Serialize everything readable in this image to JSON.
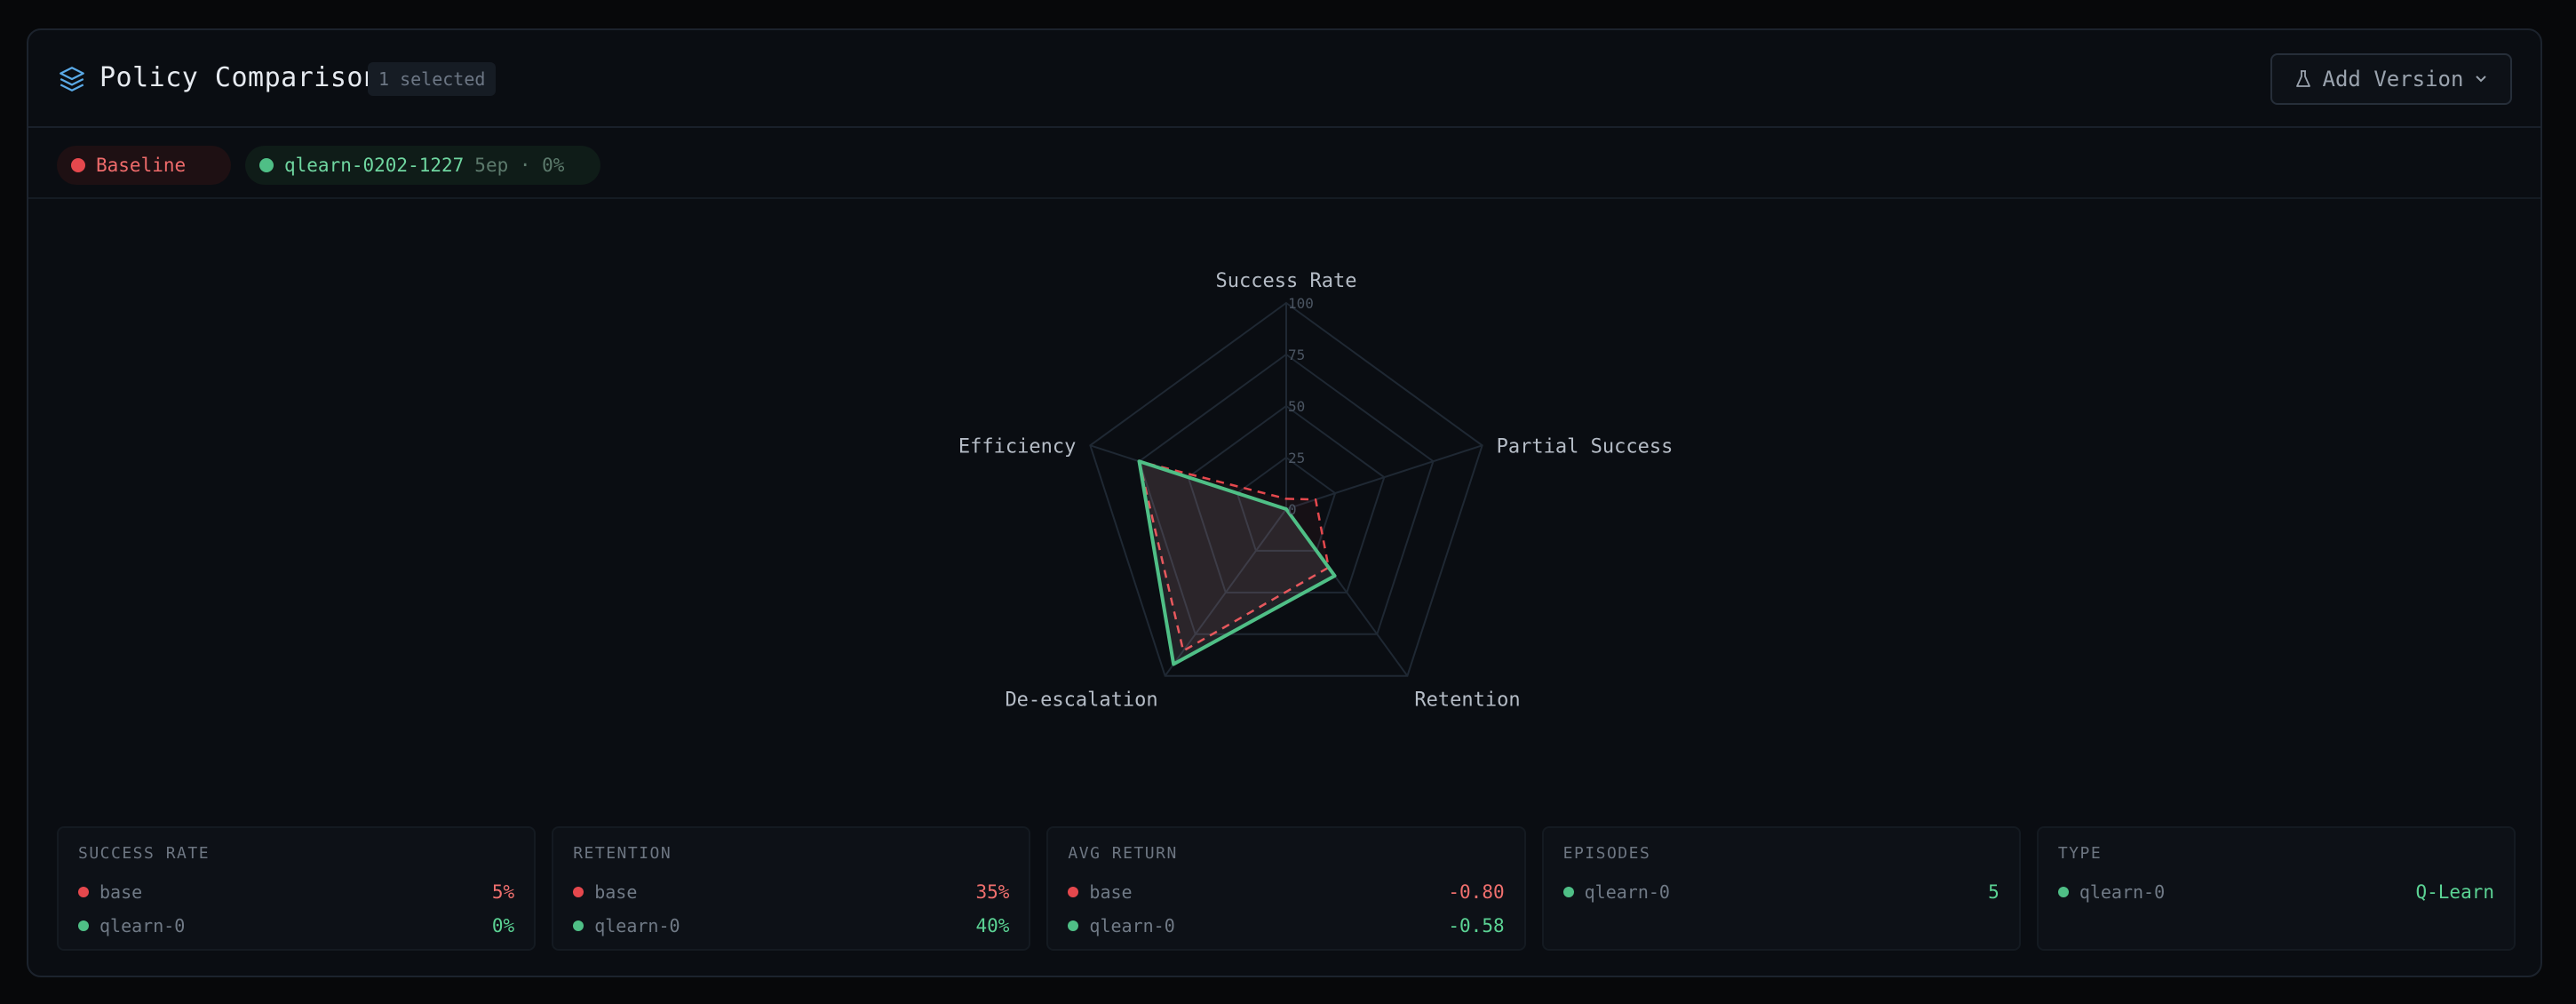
{
  "header": {
    "title": "Policy Comparison",
    "selected_badge": "1 selected",
    "add_version_label": "Add Version"
  },
  "chips": [
    {
      "label": "Baseline",
      "color": "#e5484d"
    },
    {
      "label": "qlearn-0202-1227",
      "meta": "5ep · 0%",
      "color": "#4fbf86"
    }
  ],
  "chart_data": {
    "type": "radar",
    "axes": [
      "Success Rate",
      "Partial Success",
      "Retention",
      "De-escalation",
      "Efficiency"
    ],
    "ticks": [
      "100",
      "75",
      "50",
      "25",
      "0"
    ],
    "rmax": 100,
    "grid": true,
    "series": [
      {
        "name": "Baseline",
        "color": "#e5484d",
        "style": "dashed",
        "values": [
          5,
          15,
          35,
          85,
          75
        ]
      },
      {
        "name": "qlearn-0202-1227",
        "color": "#4fbf86",
        "style": "solid",
        "values": [
          0,
          0,
          40,
          93,
          75
        ]
      }
    ]
  },
  "stats": {
    "success_rate": {
      "title": "SUCCESS RATE",
      "rows": [
        {
          "name": "base",
          "value": "5%"
        },
        {
          "name": "qlearn-0",
          "value": "0%"
        }
      ]
    },
    "retention": {
      "title": "RETENTION",
      "rows": [
        {
          "name": "base",
          "value": "35%"
        },
        {
          "name": "qlearn-0",
          "value": "40%"
        }
      ]
    },
    "avg_return": {
      "title": "AVG RETURN",
      "rows": [
        {
          "name": "base",
          "value": "-0.80"
        },
        {
          "name": "qlearn-0",
          "value": "-0.58"
        }
      ]
    },
    "episodes": {
      "title": "EPISODES",
      "rows": [
        {
          "name": "qlearn-0",
          "value": "5"
        }
      ]
    },
    "type": {
      "title": "TYPE",
      "rows": [
        {
          "name": "qlearn-0",
          "value": "Q-Learn"
        }
      ]
    }
  }
}
